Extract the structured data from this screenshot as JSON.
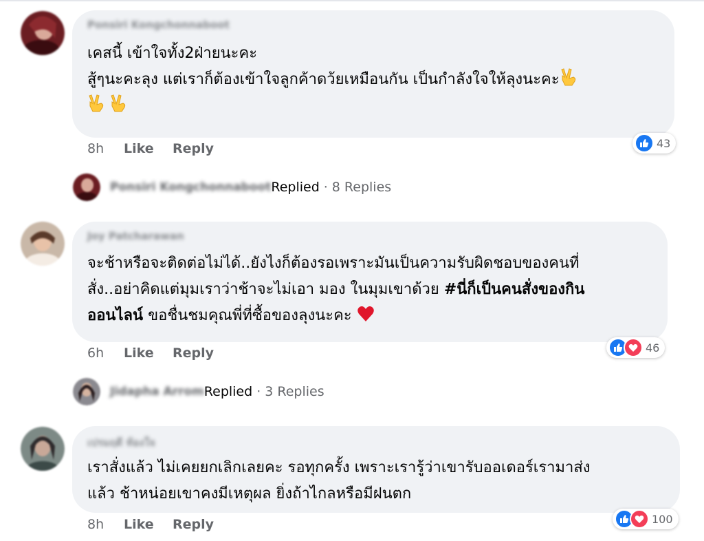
{
  "comments": [
    {
      "author": "Ponsiri Kongchonnaboot",
      "lines": [
        "เคสนี้ เข้าใจทั้ง2ฝ่ายนะคะ",
        "สู้ๆนะคะลุง แต่เราก็ต้องเข้าใจลูกค้าดว้ยเหมือนกัน เป็นกำลังใจให้ลุงนะคะ"
      ],
      "time": "8h",
      "like_label": "Like",
      "reply_label": "Reply",
      "reaction_count": "43",
      "reactions": [
        "like-icon"
      ],
      "replied": {
        "name": "Ponsiri Kongchonnaboot",
        "word": "Replied",
        "count": "8 Replies"
      }
    },
    {
      "author": "Joy Patcharawan",
      "lines": [
        "จะช้าหรือจะติดต่อไม่ได้..ยังไงก็ต้องรอเพราะมันเป็นความรับผิดชอบของคนที่",
        "สั่ง..อย่าคิดแต่มุมเราว่าช้าจะไม่เอา มอง ในมุมเขาด้วย",
        "ขอชื่นชมคุณพี่ที่ซื้อของลุงนะคะ"
      ],
      "hashtag_part1": "#นี่ก็เป็นคนสั่งของกิน",
      "hashtag_part2": "ออนไลน์",
      "time": "6h",
      "like_label": "Like",
      "reply_label": "Reply",
      "reaction_count": "46",
      "reactions": [
        "like-icon",
        "love-icon"
      ],
      "replied": {
        "name": "Jidapha Arrom",
        "word": "Replied",
        "count": "3 Replies"
      }
    },
    {
      "author": "เปรมฤดี ท้องใจ",
      "lines": [
        "เราสั่งแล้ว ไม่เคยยกเลิกเลยคะ รอทุกครั้ง เพราะเรารู้ว่าเขารับออเดอร์เรามาส่ง",
        "แล้ว ช้าหน่อยเขาคงมีเหตุผล ยิ่งถ้าไกลหรือมีฝนตก"
      ],
      "time": "8h",
      "like_label": "Like",
      "reply_label": "Reply",
      "reaction_count": "100",
      "reactions": [
        "like-icon",
        "love-icon"
      ]
    }
  ],
  "separator": "·",
  "colors": {
    "bubble": "#f0f2f5",
    "meta_text": "#65676b",
    "like_blue": "#1877f2",
    "love_red": "#f33e58"
  }
}
